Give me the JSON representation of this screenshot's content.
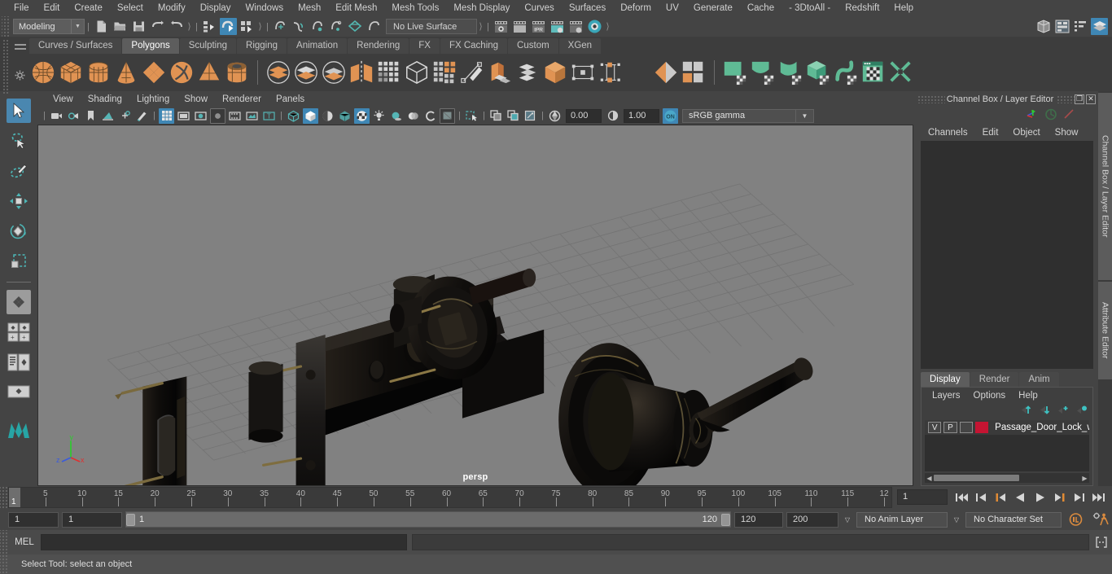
{
  "app": {
    "title": "Autodesk Maya"
  },
  "menubar": {
    "items": [
      {
        "label": "File"
      },
      {
        "label": "Edit"
      },
      {
        "label": "Create"
      },
      {
        "label": "Select"
      },
      {
        "label": "Modify"
      },
      {
        "label": "Display"
      },
      {
        "label": "Windows"
      },
      {
        "label": "Mesh"
      },
      {
        "label": "Edit Mesh"
      },
      {
        "label": "Mesh Tools"
      },
      {
        "label": "Mesh Display"
      },
      {
        "label": "Curves"
      },
      {
        "label": "Surfaces"
      },
      {
        "label": "Deform"
      },
      {
        "label": "UV"
      },
      {
        "label": "Generate"
      },
      {
        "label": "Cache"
      },
      {
        "label": "- 3DtoAll -"
      },
      {
        "label": "Redshift"
      },
      {
        "label": "Help"
      }
    ]
  },
  "statusline": {
    "menuset": {
      "value": "Modeling"
    },
    "live_surface": {
      "value": "No Live Surface"
    },
    "icons": [
      {
        "name": "new-scene-icon"
      },
      {
        "name": "open-scene-icon"
      },
      {
        "name": "save-scene-icon"
      },
      {
        "name": "undo-icon"
      },
      {
        "name": "redo-icon"
      },
      {
        "name": "select-by-hierarchy-icon"
      },
      {
        "name": "select-by-object-icon",
        "active": true
      },
      {
        "name": "select-by-component-icon"
      },
      {
        "name": "snap-to-grid-icon"
      },
      {
        "name": "snap-to-curve-icon"
      },
      {
        "name": "snap-to-point-icon"
      },
      {
        "name": "snap-to-projected-center-icon"
      },
      {
        "name": "snap-to-view-plane-icon"
      },
      {
        "name": "make-live-icon"
      },
      {
        "name": "render-current-frame-icon"
      },
      {
        "name": "render-sequence-icon"
      },
      {
        "name": "ipr-render-icon"
      },
      {
        "name": "render-settings-icon"
      },
      {
        "name": "hypershade-icon"
      },
      {
        "name": "render-view-icon"
      }
    ],
    "right_icons": [
      {
        "name": "show-hide-modeling-toolkit-icon"
      },
      {
        "name": "show-hide-attribute-editor-icon"
      },
      {
        "name": "show-hide-tool-settings-icon"
      },
      {
        "name": "show-hide-channel-box-icon",
        "active": true
      }
    ]
  },
  "shelf": {
    "tabs": [
      {
        "label": "Curves / Surfaces",
        "active": false
      },
      {
        "label": "Polygons",
        "active": true
      },
      {
        "label": "Sculpting",
        "active": false
      },
      {
        "label": "Rigging",
        "active": false
      },
      {
        "label": "Animation",
        "active": false
      },
      {
        "label": "Rendering",
        "active": false
      },
      {
        "label": "FX",
        "active": false
      },
      {
        "label": "FX Caching",
        "active": false
      },
      {
        "label": "Custom",
        "active": false
      },
      {
        "label": "XGen",
        "active": false
      }
    ],
    "buttons": [
      {
        "name": "polygon-sphere-icon",
        "kind": "sphere",
        "color": "#e09353"
      },
      {
        "name": "polygon-cube-icon",
        "kind": "cube",
        "color": "#e09353"
      },
      {
        "name": "polygon-cylinder-icon",
        "kind": "cylinder",
        "color": "#e09353"
      },
      {
        "name": "polygon-cone-icon",
        "kind": "cone",
        "color": "#e09353"
      },
      {
        "name": "polygon-plane-icon",
        "kind": "diamond",
        "color": "#e09353"
      },
      {
        "name": "polygon-torus-icon",
        "kind": "torus",
        "color": "#e09353"
      },
      {
        "name": "polygon-pyramid-icon",
        "kind": "pyramid",
        "color": "#e09353"
      },
      {
        "name": "polygon-pipe-icon",
        "kind": "pipe",
        "color": "#e09353"
      },
      {
        "name": "boolean-union-icon",
        "kind": "circlestack",
        "color": "#e09353"
      },
      {
        "name": "boolean-difference-icon",
        "kind": "circlestack2",
        "color": "#cccccc"
      },
      {
        "name": "boolean-intersection-icon",
        "kind": "circlestack3",
        "color": "#cccccc"
      },
      {
        "name": "combine-icon",
        "kind": "mirror",
        "color": "#e09353"
      },
      {
        "name": "smooth-icon",
        "kind": "grid4",
        "color": "#cccccc"
      },
      {
        "name": "extract-icon",
        "kind": "cubeoutline",
        "color": "#cccccc"
      },
      {
        "name": "quadrangulate-icon",
        "kind": "gridorange",
        "color": "#e09353"
      },
      {
        "name": "multi-cut-icon",
        "kind": "knife",
        "color": "#cccccc"
      },
      {
        "name": "extrude-icon",
        "kind": "extrude",
        "color": "#e09353"
      },
      {
        "name": "bevel-icon",
        "kind": "layers",
        "color": "#cccccc"
      },
      {
        "name": "bridge-icon",
        "kind": "cubeorange",
        "color": "#e09353"
      },
      {
        "name": "target-weld-icon",
        "kind": "rect-node",
        "color": "#cccccc"
      },
      {
        "name": "connect-icon",
        "kind": "tall-node",
        "color": "#e09353"
      },
      {
        "name": "detach-icon",
        "kind": "split-quad",
        "color": "#e09353"
      },
      {
        "name": "transform-node-icon",
        "kind": "xform",
        "color": "#e09353"
      },
      {
        "name": "uv-editor-icon",
        "kind": "quad-blocks",
        "color": "#e09353"
      },
      {
        "name": "uv-planar-icon",
        "kind": "green-plane",
        "color": "#5fbb95"
      },
      {
        "name": "uv-cylindrical-icon",
        "kind": "green-cyl",
        "color": "#5fbb95"
      },
      {
        "name": "uv-spherical-icon",
        "kind": "green-sph",
        "color": "#5fbb95"
      },
      {
        "name": "uv-automatic-icon",
        "kind": "green-cube",
        "color": "#5fbb95"
      },
      {
        "name": "uv-unfold-icon",
        "kind": "green-wave",
        "color": "#5fbb95"
      },
      {
        "name": "uv-editor-window-icon",
        "kind": "green-window",
        "color": "#5fbb95"
      },
      {
        "name": "uv-cut-icon",
        "kind": "green-cut",
        "color": "#5fbb95"
      }
    ]
  },
  "toolbox": {
    "items": [
      {
        "name": "select-tool",
        "selected": true
      },
      {
        "name": "lasso-select-tool",
        "selected": false
      },
      {
        "name": "paint-select-tool",
        "selected": false
      },
      {
        "name": "move-tool",
        "selected": false
      },
      {
        "name": "rotate-tool",
        "selected": false
      },
      {
        "name": "scale-tool",
        "selected": false
      },
      {
        "name": "last-tool-used",
        "selected": false
      },
      {
        "name": "four-view-layout",
        "selected": false
      },
      {
        "name": "persp-outliner-layout",
        "selected": false
      },
      {
        "name": "single-perspective-view",
        "selected": false
      },
      {
        "name": "maya-logo",
        "selected": false
      }
    ]
  },
  "viewport": {
    "menus": [
      {
        "label": "View"
      },
      {
        "label": "Shading"
      },
      {
        "label": "Lighting"
      },
      {
        "label": "Show"
      },
      {
        "label": "Renderer"
      },
      {
        "label": "Panels"
      }
    ],
    "camera_label": "persp",
    "exposure": "0.00",
    "gamma_value": "1.00",
    "color_management": "sRGB gamma",
    "toolbar_icons": [
      {
        "name": "select-camera-icon"
      },
      {
        "name": "camera-attributes-icon"
      },
      {
        "name": "bookmarks-icon"
      },
      {
        "name": "image-plane-icon"
      },
      {
        "name": "two-d-pan-zoom-icon"
      },
      {
        "name": "grease-pencil-icon"
      },
      {
        "name": "grid-toggle-icon",
        "active": true
      },
      {
        "name": "film-gate-icon"
      },
      {
        "name": "resolution-gate-icon"
      },
      {
        "name": "gate-mask-icon",
        "framed": true
      },
      {
        "name": "field-chart-icon"
      },
      {
        "name": "safe-action-icon"
      },
      {
        "name": "safe-title-icon"
      },
      {
        "name": "wireframe-icon"
      },
      {
        "name": "smooth-shade-all-icon",
        "active": true
      },
      {
        "name": "smooth-shade-selected-icon"
      },
      {
        "name": "shaded-wireframe-icon"
      },
      {
        "name": "textured-icon",
        "active": true
      },
      {
        "name": "use-default-lighting-icon"
      },
      {
        "name": "shadows-icon"
      },
      {
        "name": "ambient-occlusion-icon"
      },
      {
        "name": "motion-blur-icon"
      },
      {
        "name": "multisample-icon"
      },
      {
        "name": "viewport-effects-icon",
        "framed": true
      },
      {
        "name": "isolate-select-icon"
      },
      {
        "name": "xray-icon"
      },
      {
        "name": "xray-joints-icon"
      },
      {
        "name": "xray-active-components-icon"
      }
    ],
    "axis_labels": {
      "x": "x",
      "y": "y",
      "z": "z"
    }
  },
  "channelbox": {
    "title": "Channel Box / Layer Editor",
    "window_buttons": [
      {
        "name": "restore-button",
        "glyph": "❐"
      },
      {
        "name": "close-button",
        "glyph": "✕"
      }
    ],
    "menus": [
      {
        "label": "Channels"
      },
      {
        "label": "Edit"
      },
      {
        "label": "Object"
      },
      {
        "label": "Show"
      }
    ],
    "header_icons": [
      {
        "name": "show-transform-attributes-icon"
      },
      {
        "name": "show-shape-attributes-icon"
      },
      {
        "name": "show-input-output-icon"
      }
    ]
  },
  "layereditor": {
    "tabs": [
      {
        "label": "Display",
        "active": true
      },
      {
        "label": "Render",
        "active": false
      },
      {
        "label": "Anim",
        "active": false
      }
    ],
    "menus": [
      {
        "label": "Layers"
      },
      {
        "label": "Options"
      },
      {
        "label": "Help"
      }
    ],
    "buttons": [
      {
        "name": "move-layer-up-icon"
      },
      {
        "name": "move-layer-down-icon"
      },
      {
        "name": "create-new-layer-icon"
      },
      {
        "name": "create-layer-from-selected-icon"
      }
    ],
    "layers": [
      {
        "visibility": "V",
        "playback": "P",
        "shading": "",
        "color": "#c41432",
        "name": "Passage_Door_Lock_w"
      }
    ]
  },
  "dock_side_tabs": [
    {
      "label": "Channel Box / Layer Editor"
    },
    {
      "label": "Attribute Editor"
    }
  ],
  "timeslider": {
    "current_frame": "1",
    "start": 1,
    "end": 120,
    "ticks": [
      {
        "label": "5",
        "value": 5
      },
      {
        "label": "10",
        "value": 10
      },
      {
        "label": "15",
        "value": 15
      },
      {
        "label": "20",
        "value": 20
      },
      {
        "label": "25",
        "value": 25
      },
      {
        "label": "30",
        "value": 30
      },
      {
        "label": "35",
        "value": 35
      },
      {
        "label": "40",
        "value": 40
      },
      {
        "label": "45",
        "value": 45
      },
      {
        "label": "50",
        "value": 50
      },
      {
        "label": "55",
        "value": 55
      },
      {
        "label": "60",
        "value": 60
      },
      {
        "label": "65",
        "value": 65
      },
      {
        "label": "70",
        "value": 70
      },
      {
        "label": "75",
        "value": 75
      },
      {
        "label": "80",
        "value": 80
      },
      {
        "label": "85",
        "value": 85
      },
      {
        "label": "90",
        "value": 90
      },
      {
        "label": "95",
        "value": 95
      },
      {
        "label": "100",
        "value": 100
      },
      {
        "label": "105",
        "value": 105
      },
      {
        "label": "110",
        "value": 110
      },
      {
        "label": "115",
        "value": 115
      },
      {
        "label": "12",
        "value": 120
      }
    ],
    "frame_field": "1",
    "playback_buttons": [
      {
        "name": "go-to-start-icon"
      },
      {
        "name": "step-back-keyframe-icon"
      },
      {
        "name": "step-back-frame-icon"
      },
      {
        "name": "play-backwards-icon"
      },
      {
        "name": "play-forwards-icon"
      },
      {
        "name": "step-forward-frame-icon"
      },
      {
        "name": "step-forward-keyframe-icon"
      },
      {
        "name": "go-to-end-icon"
      }
    ]
  },
  "rangeslider": {
    "anim_start": "1",
    "range_start": "1",
    "slider_min_label": "1",
    "slider_max_label": "120",
    "range_end": "120",
    "anim_end": "200",
    "anim_layer": "No Anim Layer",
    "character_set": "No Character Set",
    "right_icons": [
      {
        "name": "auto-keyframe-toggle-icon"
      },
      {
        "name": "animation-preferences-icon"
      }
    ]
  },
  "commandline": {
    "label": "MEL",
    "input_value": "",
    "output_value": "",
    "script-editor-icon": "script-editor-icon"
  },
  "statusbar": {
    "message": "Select Tool: select an object"
  },
  "colors": {
    "accent_blue": "#3f87b5",
    "accent_orange": "#e09353",
    "accent_teal": "#5fbb95",
    "layer_color": "#c41432",
    "panel_bg": "#444444",
    "viewport_bg": "#818181"
  }
}
